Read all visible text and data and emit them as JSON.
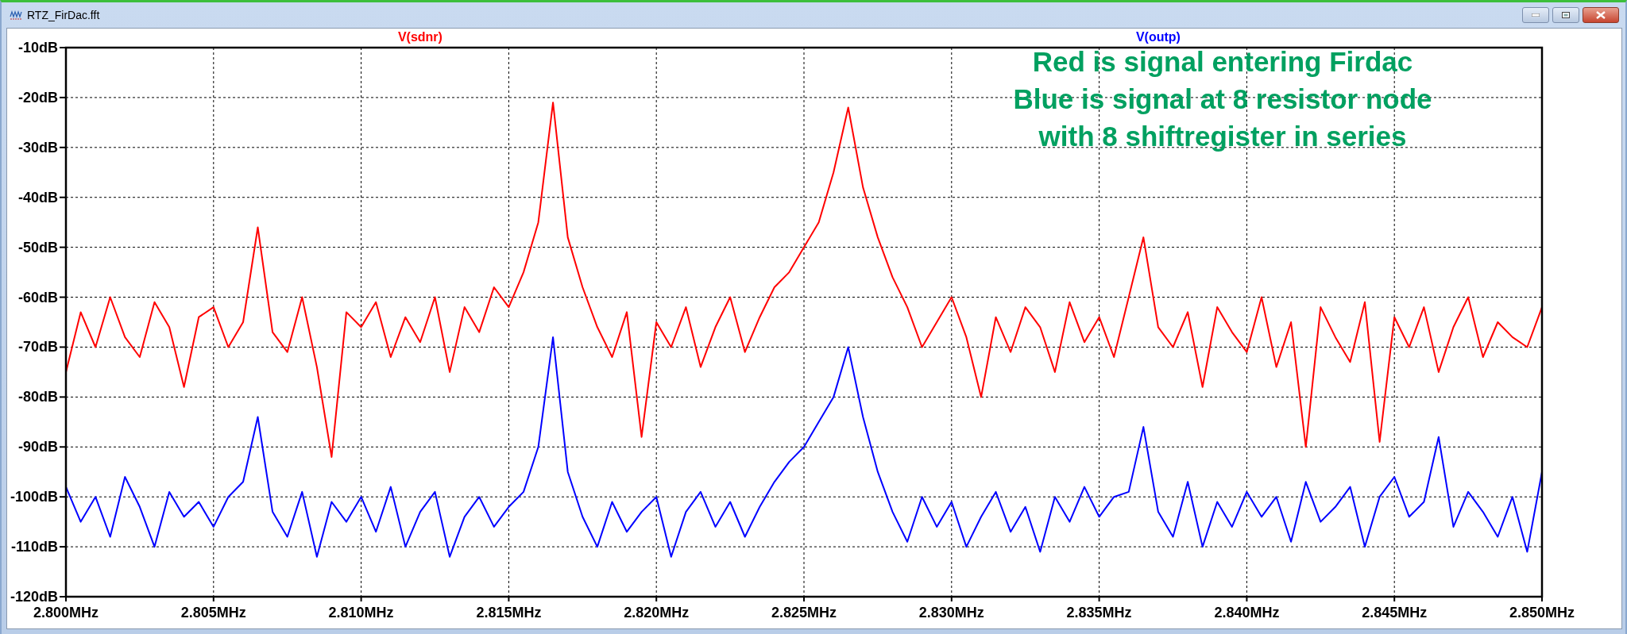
{
  "window": {
    "title": "RTZ_FirDac.fft"
  },
  "plot": {
    "annotation": [
      "Red is signal entering Firdac",
      "Blue is signal at 8 resistor node",
      "with 8 shiftregister in series"
    ],
    "chart_data": {
      "type": "line",
      "grid": true,
      "xlim": [
        2.8,
        2.85
      ],
      "ylim": [
        -120,
        -10
      ],
      "xticks": [
        {
          "value": 2.8,
          "label": "2.800MHz"
        },
        {
          "value": 2.805,
          "label": "2.805MHz"
        },
        {
          "value": 2.81,
          "label": "2.810MHz"
        },
        {
          "value": 2.815,
          "label": "2.815MHz"
        },
        {
          "value": 2.82,
          "label": "2.820MHz"
        },
        {
          "value": 2.825,
          "label": "2.825MHz"
        },
        {
          "value": 2.83,
          "label": "2.830MHz"
        },
        {
          "value": 2.835,
          "label": "2.835MHz"
        },
        {
          "value": 2.84,
          "label": "2.840MHz"
        },
        {
          "value": 2.845,
          "label": "2.845MHz"
        },
        {
          "value": 2.85,
          "label": "2.850MHz"
        }
      ],
      "yticks": [
        {
          "value": -10,
          "label": "-10dB"
        },
        {
          "value": -20,
          "label": "-20dB"
        },
        {
          "value": -30,
          "label": "-30dB"
        },
        {
          "value": -40,
          "label": "-40dB"
        },
        {
          "value": -50,
          "label": "-50dB"
        },
        {
          "value": -60,
          "label": "-60dB"
        },
        {
          "value": -70,
          "label": "-70dB"
        },
        {
          "value": -80,
          "label": "-80dB"
        },
        {
          "value": -90,
          "label": "-90dB"
        },
        {
          "value": -100,
          "label": "-100dB"
        },
        {
          "value": -110,
          "label": "-110dB"
        },
        {
          "value": -120,
          "label": "-120dB"
        }
      ],
      "x": [
        2.8,
        2.8005,
        2.801,
        2.8015,
        2.802,
        2.8025,
        2.803,
        2.8035,
        2.804,
        2.8045,
        2.805,
        2.8055,
        2.806,
        2.8065,
        2.807,
        2.8075,
        2.808,
        2.8085,
        2.809,
        2.8095,
        2.81,
        2.8105,
        2.811,
        2.8115,
        2.812,
        2.8125,
        2.813,
        2.8135,
        2.814,
        2.8145,
        2.815,
        2.8155,
        2.816,
        2.8165,
        2.817,
        2.8175,
        2.818,
        2.8185,
        2.819,
        2.8195,
        2.82,
        2.8205,
        2.821,
        2.8215,
        2.822,
        2.8225,
        2.823,
        2.8235,
        2.824,
        2.8245,
        2.825,
        2.8255,
        2.826,
        2.8265,
        2.827,
        2.8275,
        2.828,
        2.8285,
        2.829,
        2.8295,
        2.83,
        2.8305,
        2.831,
        2.8315,
        2.832,
        2.8325,
        2.833,
        2.8335,
        2.834,
        2.8345,
        2.835,
        2.8355,
        2.836,
        2.8365,
        2.837,
        2.8375,
        2.838,
        2.8385,
        2.839,
        2.8395,
        2.84,
        2.8405,
        2.841,
        2.8415,
        2.842,
        2.8425,
        2.843,
        2.8435,
        2.844,
        2.8445,
        2.845,
        2.8455,
        2.846,
        2.8465,
        2.847,
        2.8475,
        2.848,
        2.8485,
        2.849,
        2.8495,
        2.85
      ],
      "series": [
        {
          "name": "V(sdnr)",
          "color": "#ff0000",
          "values": [
            -75,
            -63,
            -70,
            -60,
            -68,
            -72,
            -61,
            -66,
            -78,
            -64,
            -62,
            -70,
            -65,
            -46,
            -67,
            -71,
            -60,
            -74,
            -92,
            -63,
            -66,
            -61,
            -72,
            -64,
            -69,
            -60,
            -75,
            -62,
            -67,
            -58,
            -62,
            -55,
            -45,
            -21,
            -48,
            -58,
            -66,
            -72,
            -63,
            -88,
            -65,
            -70,
            -62,
            -74,
            -66,
            -60,
            -71,
            -64,
            -58,
            -55,
            -50,
            -45,
            -35,
            -22,
            -38,
            -48,
            -56,
            -62,
            -70,
            -65,
            -60,
            -68,
            -80,
            -64,
            -71,
            -62,
            -66,
            -75,
            -61,
            -69,
            -64,
            -72,
            -60,
            -48,
            -66,
            -70,
            -63,
            -78,
            -62,
            -67,
            -71,
            -60,
            -74,
            -65,
            -90,
            -62,
            -68,
            -73,
            -61,
            -89,
            -64,
            -70,
            -62,
            -75,
            -66,
            -60,
            -72,
            -65,
            -68,
            -70,
            -62
          ]
        },
        {
          "name": "V(outp)",
          "color": "#0000ff",
          "values": [
            -98,
            -105,
            -100,
            -108,
            -96,
            -102,
            -110,
            -99,
            -104,
            -101,
            -106,
            -100,
            -97,
            -84,
            -103,
            -108,
            -99,
            -112,
            -101,
            -105,
            -100,
            -107,
            -98,
            -110,
            -103,
            -99,
            -112,
            -104,
            -100,
            -106,
            -102,
            -99,
            -90,
            -68,
            -95,
            -104,
            -110,
            -101,
            -107,
            -103,
            -100,
            -112,
            -103,
            -99,
            -106,
            -101,
            -108,
            -102,
            -97,
            -93,
            -90,
            -85,
            -80,
            -70,
            -84,
            -95,
            -103,
            -109,
            -100,
            -106,
            -101,
            -110,
            -104,
            -99,
            -107,
            -102,
            -111,
            -100,
            -105,
            -98,
            -104,
            -100,
            -99,
            -86,
            -103,
            -108,
            -97,
            -110,
            -101,
            -106,
            -99,
            -104,
            -100,
            -109,
            -97,
            -105,
            -102,
            -98,
            -110,
            -100,
            -96,
            -104,
            -101,
            -88,
            -106,
            -99,
            -103,
            -108,
            -100,
            -111,
            -95
          ]
        }
      ]
    }
  }
}
